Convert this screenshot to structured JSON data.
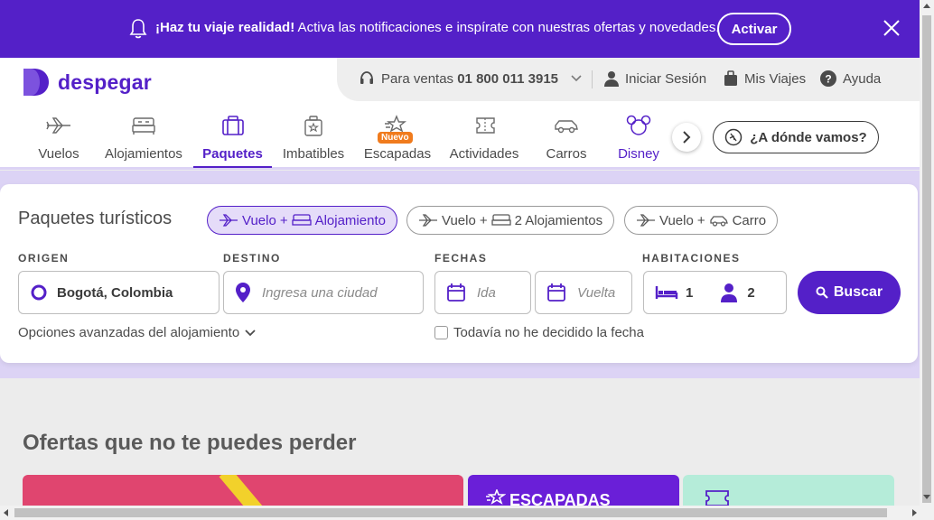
{
  "banner": {
    "bold_text": "¡Haz tu viaje realidad!",
    "text": " Activa las notificaciones e inspírate con nuestras ofertas y novedades.",
    "button_label": "Activar",
    "bg_color": "#5420c8"
  },
  "header": {
    "logo_text": "despegar",
    "sales_prefix": "Para ventas",
    "sales_phone": "01 800 011 3915",
    "login_label": "Iniciar Sesión",
    "trips_label": "Mis Viajes",
    "help_label": "Ayuda"
  },
  "nav": {
    "tabs": [
      {
        "label": "Vuelos",
        "icon": "plane-icon"
      },
      {
        "label": "Alojamientos",
        "icon": "bed-icon"
      },
      {
        "label": "Paquetes",
        "icon": "suitcase-icon",
        "active": true
      },
      {
        "label": "Imbatibles",
        "icon": "luggage-stars-icon"
      },
      {
        "label": "Escapadas",
        "icon": "escapadas-icon",
        "badge": "Nuevo"
      },
      {
        "label": "Actividades",
        "icon": "ticket-icon"
      },
      {
        "label": "Carros",
        "icon": "car-icon"
      },
      {
        "label": "Disney",
        "icon": "mickey-icon"
      }
    ],
    "where_label": "¿A dónde vamos?"
  },
  "search": {
    "title": "Paquetes turísticos",
    "options": [
      {
        "part1": "Vuelo",
        "part2": "Alojamiento",
        "active": true
      },
      {
        "part1": "Vuelo",
        "part2": "2 Alojamientos",
        "active": false
      },
      {
        "part1": "Vuelo",
        "part2": "Carro",
        "active": false
      }
    ],
    "origin_label": "ORIGEN",
    "origin_value": "Bogotá, Colombia",
    "dest_label": "DESTINO",
    "dest_placeholder": "Ingresa una ciudad",
    "dates_label": "FECHAS",
    "ida_placeholder": "Ida",
    "vuelta_placeholder": "Vuelta",
    "rooms_label": "HABITACIONES",
    "rooms_count": "1",
    "people_count": "2",
    "search_button": "Buscar",
    "advanced_options": "Opciones avanzadas del alojamiento",
    "no_date_label": "Todavía no he decidido la fecha"
  },
  "offers": {
    "title": "Ofertas que no te puedes perder",
    "card2_title": "ESCAPADAS"
  }
}
